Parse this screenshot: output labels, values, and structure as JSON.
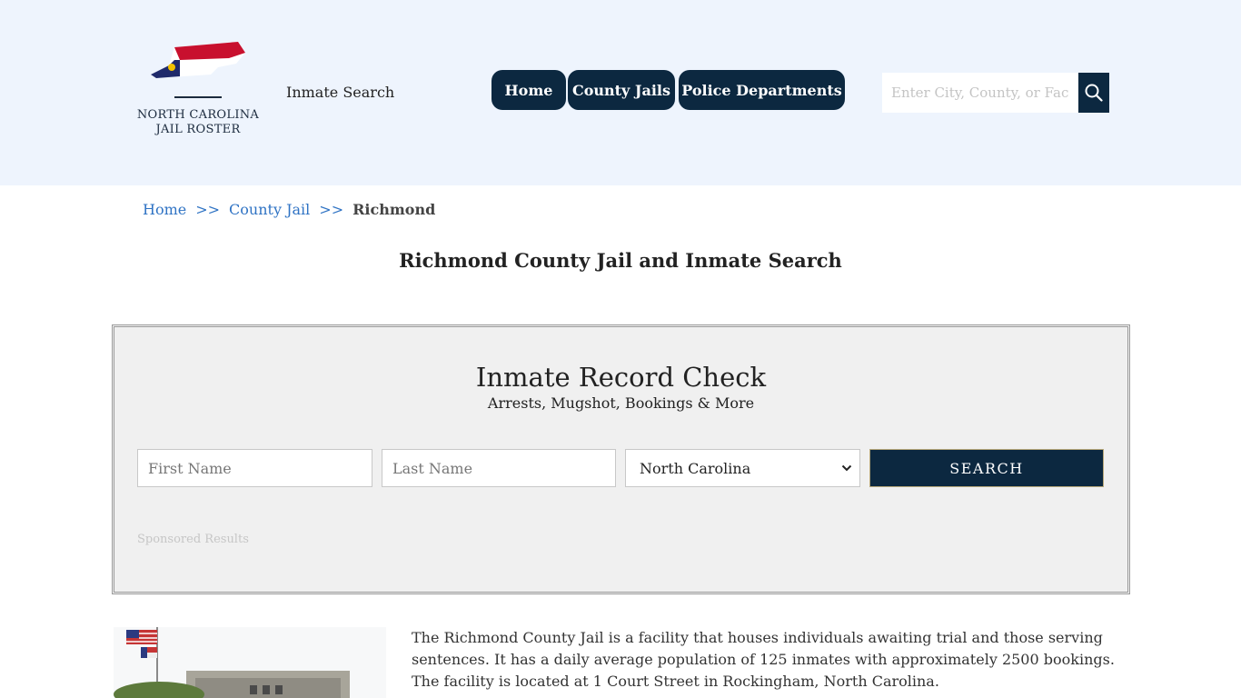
{
  "header": {
    "logo_line1": "NORTH CAROLINA",
    "logo_line2": "JAIL ROSTER",
    "inmate_search_link": "Inmate Search",
    "nav": [
      {
        "label": "Home"
      },
      {
        "label": "County Jails"
      },
      {
        "label": "Police Departments"
      }
    ],
    "search_placeholder": "Enter City, County, or Facility",
    "search_icon": "search-icon"
  },
  "breadcrumb": {
    "items": [
      "Home",
      "County Jail"
    ],
    "separator": ">>",
    "current": "Richmond"
  },
  "page_title": "Richmond County Jail and Inmate Search",
  "record_check": {
    "title": "Inmate Record Check",
    "subtitle": "Arrests, Mugshot, Bookings & More",
    "first_name_placeholder": "First Name",
    "last_name_placeholder": "Last Name",
    "state_selected": "North Carolina",
    "search_label": "SEARCH",
    "sponsored": "Sponsored Results"
  },
  "description": "The Richmond County Jail is a facility that houses individuals awaiting trial and those serving sentences. It has a daily average population of 125 inmates with approximately 2500 bookings. The facility is located at 1 Court Street in Rockingham, North Carolina.",
  "colors": {
    "header_bg": "#eef4fd",
    "nav_bg": "#0c2840",
    "link": "#2f73c4"
  }
}
